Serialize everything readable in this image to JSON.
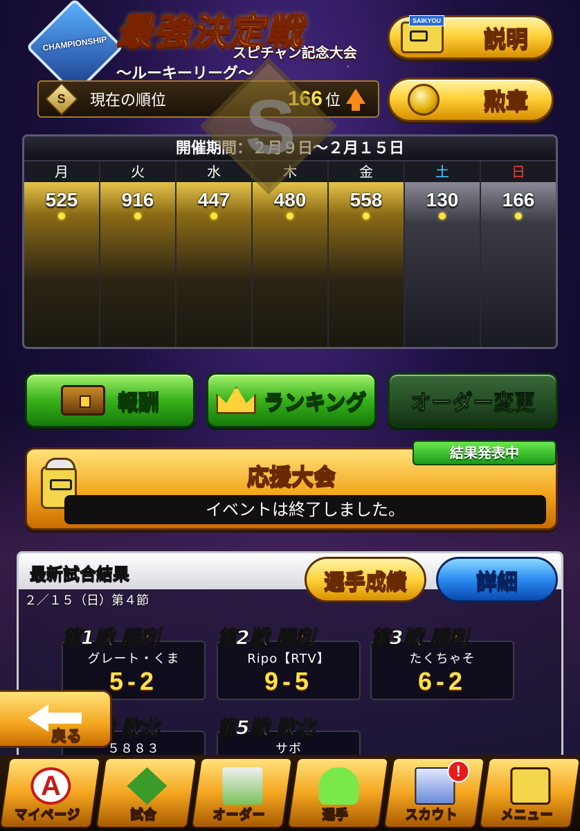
{
  "header": {
    "logo_text": "CHAMPIONSHIP",
    "title": "最強決定戦",
    "subtitle": "スピチャン記念大会",
    "league": "〜ルーキーリーグ〜",
    "rank_badge": "S",
    "rank_label": "現在の順位",
    "rank_value": "166",
    "rank_unit": "位",
    "rank_trend_icon": "arrow-up-icon",
    "help_tag": "SAIKYOU",
    "help_label": "説明",
    "medal_label": "勲章"
  },
  "period": {
    "label": "開催期間：２月９日〜２月１５日",
    "emblem": "S",
    "days": [
      {
        "name": "月",
        "score": "525",
        "color": "#ffffff"
      },
      {
        "name": "火",
        "score": "916",
        "color": "#ffffff"
      },
      {
        "name": "水",
        "score": "447",
        "color": "#ffffff"
      },
      {
        "name": "木",
        "score": "480",
        "color": "#ffffff"
      },
      {
        "name": "金",
        "score": "558",
        "color": "#ffffff"
      },
      {
        "name": "土",
        "score": "130",
        "color": "#4ad0ff"
      },
      {
        "name": "日",
        "score": "166",
        "color": "#ff3a3a"
      }
    ]
  },
  "actions": {
    "reward_label": "報酬",
    "ranking_label": "ランキング",
    "order_label": "オーダー変更"
  },
  "support": {
    "title": "応援大会",
    "message": "イベントは終了しました。",
    "status": "結果発表中"
  },
  "results": {
    "title": "最新試合結果",
    "date": "２／１５（日）第４節",
    "stats_label": "選手成績",
    "detail_label": "詳細",
    "matches": [
      {
        "num": "第1戦",
        "result": "勝利",
        "opponent": "グレート・くま",
        "score": "5-2"
      },
      {
        "num": "第2戦",
        "result": "勝利",
        "opponent": "Ripo【RTV】",
        "score": "9-5"
      },
      {
        "num": "第3戦",
        "result": "勝利",
        "opponent": "たくちゃそ",
        "score": "6-2"
      },
      {
        "num": "第4戦",
        "result": "敗北",
        "opponent": "５８８３",
        "score": ""
      },
      {
        "num": "第5戦",
        "result": "敗北",
        "opponent": "サボ",
        "score": ""
      }
    ]
  },
  "back": {
    "label": "戻る"
  },
  "nav": {
    "items": [
      {
        "label": "マイページ",
        "icon": "a-logo-icon"
      },
      {
        "label": "試合",
        "icon": "stadium-icon"
      },
      {
        "label": "オーダー",
        "icon": "field-order-icon"
      },
      {
        "label": "選手",
        "icon": "player-icon"
      },
      {
        "label": "スカウト",
        "icon": "scout-icon",
        "badge": "!"
      },
      {
        "label": "メニュー",
        "icon": "menu-mascot-icon"
      }
    ]
  }
}
